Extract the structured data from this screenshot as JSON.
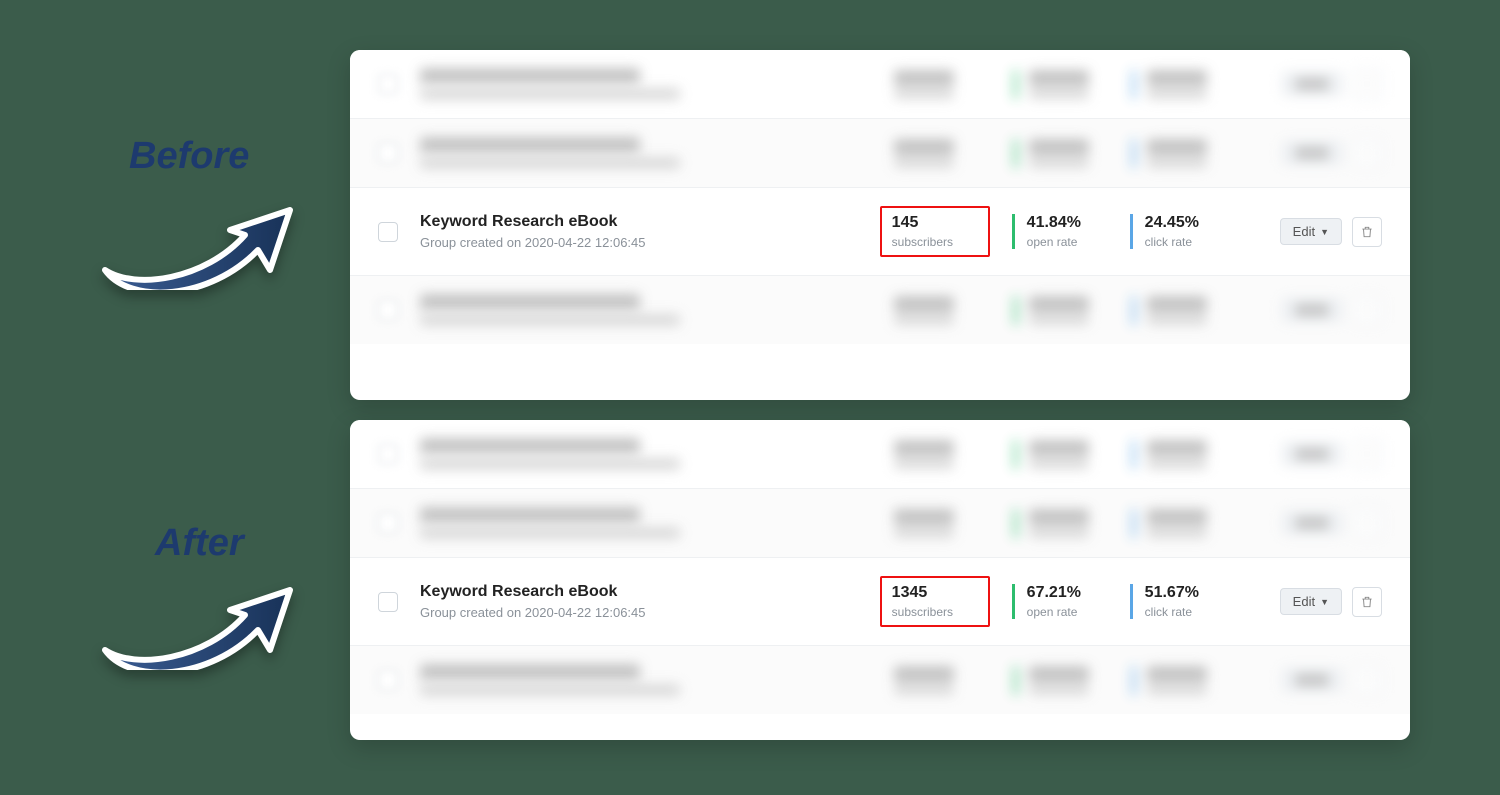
{
  "labels": {
    "before": "Before",
    "after": "After"
  },
  "common": {
    "edit_label": "Edit",
    "subs_label": "subscribers",
    "open_label": "open rate",
    "click_label": "click rate"
  },
  "before": {
    "main": {
      "title": "Keyword Research eBook",
      "created": "Group created on 2020-04-22 12:06:45",
      "subs": "145",
      "open": "41.84%",
      "click": "24.45%"
    }
  },
  "after": {
    "main": {
      "title": "Keyword Research eBook",
      "created": "Group created on 2020-04-22 12:06:45",
      "subs": "1345",
      "open": "67.21%",
      "click": "51.67%"
    }
  }
}
